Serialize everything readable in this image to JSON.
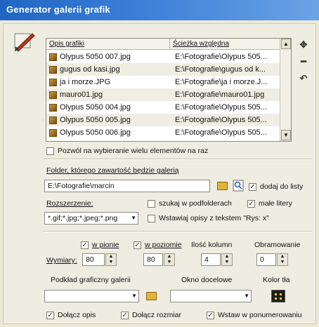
{
  "window": {
    "title": "Generator galerii grafik"
  },
  "list": {
    "headers": [
      "Opis grafiki",
      "Ścieżka względna"
    ],
    "rows": [
      {
        "name": "Olypus 5050 007.jpg",
        "path": "E:\\Fotografie\\Olypus 505..."
      },
      {
        "name": "gugus od kasi.jpg",
        "path": "E:\\Fotografie\\gugus od k..."
      },
      {
        "name": "ja i morze.JPG",
        "path": "E:\\Fotografie\\ja i morze.J..."
      },
      {
        "name": "mauro01.jpg",
        "path": "E:\\Fotografie\\mauro01.jpg"
      },
      {
        "name": "Olypus 5050 004.jpg",
        "path": "E:\\Fotografie\\Olypus 505..."
      },
      {
        "name": "Olypus 5050 005.jpg",
        "path": "E:\\Fotografie\\Olypus 505..."
      },
      {
        "name": "Olypus 5050 006.jpg",
        "path": "E:\\Fotografie\\Olypus 505..."
      }
    ]
  },
  "multi_select_label": "Pozwól na wybieranie wielu elementów na raz",
  "folder": {
    "label": "Folder, którego zawartość będzie galerią",
    "value": "E:\\Fotografie\\marcin",
    "add_to_list_label": "dodaj do listy"
  },
  "extensions": {
    "label": "Rozszerzenie:",
    "value": "*.gif;*.jpg;*.jpeg;*.png"
  },
  "options": {
    "search_subfolders": "szukaj w podfolderach",
    "lowercase": "małe litery",
    "insert_captions": "Wstawiaj opisy z tekstem \"Rys: x\""
  },
  "dimensions": {
    "vertical_label": "w pionie",
    "horizontal_label": "w poziomie",
    "columns_label": "Ilość kolumn",
    "border_label": "Obramowanie",
    "size_label": "Wymiary:",
    "vertical_value": "80",
    "horizontal_value": "80",
    "columns_value": "4",
    "border_value": "0"
  },
  "background": {
    "gallery_bg_label": "Podkład graficzny galerii",
    "window_label": "Okno docelowe",
    "color_label": "Kolor tła"
  },
  "bottom": {
    "attach_caption": "Dołącz opis",
    "attach_size": "Dołącz rozmiar",
    "insert_in_brackets": "Wstaw w ponumerowaniu"
  },
  "colors": {
    "title_bar": "#2a70c9",
    "bg_swatch": "#1c1f18"
  }
}
